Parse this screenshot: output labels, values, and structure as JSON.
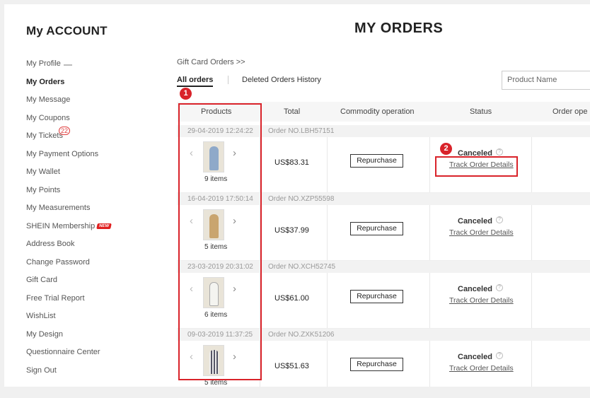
{
  "sidebar": {
    "title": "My ACCOUNT",
    "items": [
      {
        "label": "My Profile"
      },
      {
        "label": "My Orders"
      },
      {
        "label": "My Message"
      },
      {
        "label": "My Coupons"
      },
      {
        "label": "My Tickets",
        "count": "22"
      },
      {
        "label": "My Payment Options"
      },
      {
        "label": "My Wallet"
      },
      {
        "label": "My Points"
      },
      {
        "label": "My Measurements"
      },
      {
        "label": "SHEIN Membership",
        "badge": "NEW"
      },
      {
        "label": "Address Book"
      },
      {
        "label": "Change Password"
      },
      {
        "label": "Gift Card"
      },
      {
        "label": "Free Trial Report"
      },
      {
        "label": "WishList"
      },
      {
        "label": "My Design"
      },
      {
        "label": "Questionnaire Center"
      },
      {
        "label": "Sign Out"
      }
    ]
  },
  "main": {
    "title": "MY ORDERS",
    "breadcrumb": "Gift Card Orders >>",
    "tabs": [
      "All orders",
      "Deleted Orders History"
    ],
    "search_placeholder": "Product Name",
    "columns": [
      "Products",
      "Total",
      "Commodity operation",
      "Status",
      "Order ope"
    ],
    "orders": [
      {
        "date": "29-04-2019 12:24:22",
        "order_no": "Order NO.LBH57151",
        "items": "9 items",
        "total": "US$83.31",
        "button": "Repurchase",
        "status": "Canceled",
        "link": "Track Order Details"
      },
      {
        "date": "16-04-2019 17:50:14",
        "order_no": "Order NO.XZP55598",
        "items": "5 items",
        "total": "US$37.99",
        "button": "Repurchase",
        "status": "Canceled",
        "link": "Track Order Details"
      },
      {
        "date": "23-03-2019 20:31:02",
        "order_no": "Order NO.XCH52745",
        "items": "6 items",
        "total": "US$61.00",
        "button": "Repurchase",
        "status": "Canceled",
        "link": "Track Order Details"
      },
      {
        "date": "09-03-2019 11:37:25",
        "order_no": "Order NO.ZXK51206",
        "items": "5 items",
        "total": "US$51.63",
        "button": "Repurchase",
        "status": "Canceled",
        "link": "Track Order Details"
      }
    ]
  },
  "annotations": {
    "marker_1": "1",
    "marker_2": "2",
    "color": "#d9232a"
  }
}
